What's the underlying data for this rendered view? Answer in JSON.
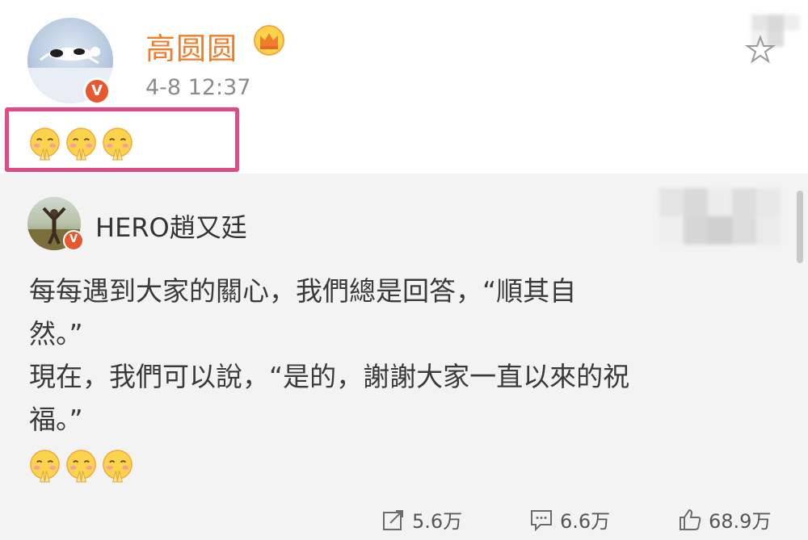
{
  "post": {
    "username": "高圆圆",
    "time": "4-8 12:37",
    "verified_mark": "V",
    "emojis": [
      "pray-face-icon",
      "pray-face-icon",
      "pray-face-icon"
    ]
  },
  "repost": {
    "username": "HERO趙又廷",
    "verified_mark": "V",
    "text_lines": [
      "每每遇到大家的關心，我們總是回答，“順其自",
      "然。”",
      "現在，我們可以說，“是的，謝謝大家一直以來的祝",
      "福。”"
    ],
    "emojis": [
      "pray-face-icon",
      "pray-face-icon",
      "pray-face-icon"
    ]
  },
  "stats": {
    "share": "5.6万",
    "comment": "6.6万",
    "like": "68.9万"
  },
  "colors": {
    "username_orange": "#f07d2c",
    "verify_orange": "#e8582e",
    "highlight_pink": "#e04b86",
    "repost_bg": "#f3f3f3"
  }
}
